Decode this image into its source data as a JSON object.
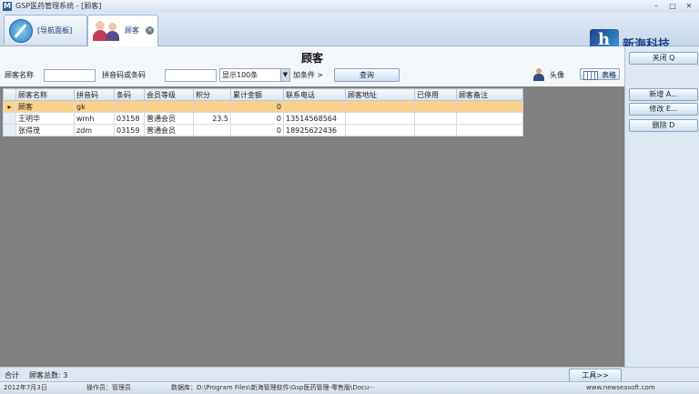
{
  "window": {
    "title": "GSP医药管理系统 - [顾客]"
  },
  "tabs": [
    {
      "label": "[导航面板]"
    },
    {
      "label": "顾客"
    }
  ],
  "brand": {
    "name": "新海科技"
  },
  "page": {
    "title": "顾客"
  },
  "filters": {
    "name_label": "顾客名称",
    "pinyin_label": "拼音码或条码",
    "display_select": "显示100条",
    "more_conditions": "加条件 >",
    "search_button": "查询",
    "avatar_label": "头像",
    "table_view": "表格"
  },
  "grid": {
    "columns": [
      "顾客名称",
      "拼音码",
      "条码",
      "会员等级",
      "积分",
      "累计金额",
      "联系电话",
      "顾客地址",
      "已停用",
      "顾客备注"
    ],
    "rows": [
      {
        "name": "顾客",
        "pinyin": "gk",
        "barcode": "",
        "level": "",
        "points": "",
        "total": "0",
        "phone": "",
        "address": "",
        "disabled": "",
        "note": "",
        "selected": true
      },
      {
        "name": "王明华",
        "pinyin": "wmh",
        "barcode": "03158",
        "level": "普通会员",
        "points": "23.5",
        "total": "0",
        "phone": "13514568564",
        "address": "",
        "disabled": "",
        "note": "",
        "selected": false
      },
      {
        "name": "张得茂",
        "pinyin": "zdm",
        "barcode": "03159",
        "level": "普通会员",
        "points": "",
        "total": "0",
        "phone": "18925622436",
        "address": "",
        "disabled": "",
        "note": "",
        "selected": false
      }
    ]
  },
  "side_buttons": {
    "close": "关闭 Q",
    "add": "新增 A...",
    "edit": "修改 E...",
    "delete": "删除 D"
  },
  "footer": {
    "total_label": "合计",
    "count_label": "顾客总数: 3",
    "tools_button": "工具>>"
  },
  "status": {
    "date": "2012年7月3日",
    "operator": "操作员：管理员",
    "database": "数据库：D:\\Program Files\\新海管理软件\\Gsp医药管理-零售版\\Docu···",
    "website": "www.newseasoft.com"
  }
}
